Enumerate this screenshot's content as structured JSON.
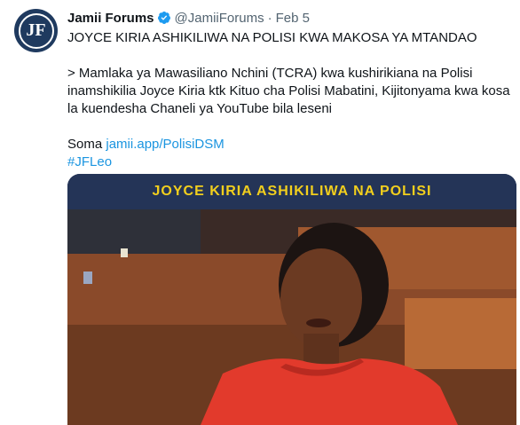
{
  "tweet": {
    "author_name": "Jamii Forums",
    "handle": "@JamiiForums",
    "separator": "·",
    "date": "Feb 5",
    "avatar_letters": "JF",
    "lines": {
      "headline": "JOYCE KIRIA ASHIKILIWA NA POLISI KWA MAKOSA YA MTANDAO",
      "body": "> Mamlaka ya Mawasiliano  Nchini (TCRA) kwa kushirikiana na Polisi inamshikilia Joyce Kiria ktk Kituo cha Polisi Mabatini, Kijitonyama kwa kosa la kuendesha Chaneli ya YouTube bila leseni",
      "soma_label": "Soma",
      "link_text": "jamii.app/PolisiDSM",
      "hashtag": "#JFLeo"
    },
    "media": {
      "banner_text": "JOYCE KIRIA ASHIKILIWA NA POLISI"
    }
  },
  "colors": {
    "link": "#1b95e0",
    "verified": "#1d9bf0",
    "banner_bg": "#243457",
    "banner_text": "#f2cf1d"
  }
}
